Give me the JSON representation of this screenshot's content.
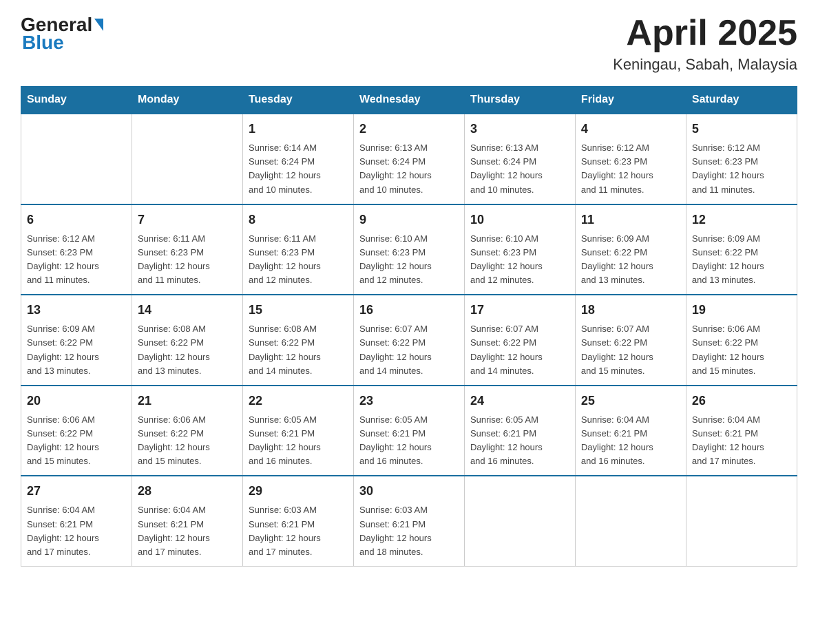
{
  "logo": {
    "general": "General",
    "blue": "Blue"
  },
  "title": "April 2025",
  "subtitle": "Keningau, Sabah, Malaysia",
  "days_of_week": [
    "Sunday",
    "Monday",
    "Tuesday",
    "Wednesday",
    "Thursday",
    "Friday",
    "Saturday"
  ],
  "weeks": [
    [
      {
        "day": "",
        "info": ""
      },
      {
        "day": "",
        "info": ""
      },
      {
        "day": "1",
        "sunrise": "6:14 AM",
        "sunset": "6:24 PM",
        "daylight": "12 hours and 10 minutes."
      },
      {
        "day": "2",
        "sunrise": "6:13 AM",
        "sunset": "6:24 PM",
        "daylight": "12 hours and 10 minutes."
      },
      {
        "day": "3",
        "sunrise": "6:13 AM",
        "sunset": "6:24 PM",
        "daylight": "12 hours and 10 minutes."
      },
      {
        "day": "4",
        "sunrise": "6:12 AM",
        "sunset": "6:23 PM",
        "daylight": "12 hours and 11 minutes."
      },
      {
        "day": "5",
        "sunrise": "6:12 AM",
        "sunset": "6:23 PM",
        "daylight": "12 hours and 11 minutes."
      }
    ],
    [
      {
        "day": "6",
        "sunrise": "6:12 AM",
        "sunset": "6:23 PM",
        "daylight": "12 hours and 11 minutes."
      },
      {
        "day": "7",
        "sunrise": "6:11 AM",
        "sunset": "6:23 PM",
        "daylight": "12 hours and 11 minutes."
      },
      {
        "day": "8",
        "sunrise": "6:11 AM",
        "sunset": "6:23 PM",
        "daylight": "12 hours and 12 minutes."
      },
      {
        "day": "9",
        "sunrise": "6:10 AM",
        "sunset": "6:23 PM",
        "daylight": "12 hours and 12 minutes."
      },
      {
        "day": "10",
        "sunrise": "6:10 AM",
        "sunset": "6:23 PM",
        "daylight": "12 hours and 12 minutes."
      },
      {
        "day": "11",
        "sunrise": "6:09 AM",
        "sunset": "6:22 PM",
        "daylight": "12 hours and 13 minutes."
      },
      {
        "day": "12",
        "sunrise": "6:09 AM",
        "sunset": "6:22 PM",
        "daylight": "12 hours and 13 minutes."
      }
    ],
    [
      {
        "day": "13",
        "sunrise": "6:09 AM",
        "sunset": "6:22 PM",
        "daylight": "12 hours and 13 minutes."
      },
      {
        "day": "14",
        "sunrise": "6:08 AM",
        "sunset": "6:22 PM",
        "daylight": "12 hours and 13 minutes."
      },
      {
        "day": "15",
        "sunrise": "6:08 AM",
        "sunset": "6:22 PM",
        "daylight": "12 hours and 14 minutes."
      },
      {
        "day": "16",
        "sunrise": "6:07 AM",
        "sunset": "6:22 PM",
        "daylight": "12 hours and 14 minutes."
      },
      {
        "day": "17",
        "sunrise": "6:07 AM",
        "sunset": "6:22 PM",
        "daylight": "12 hours and 14 minutes."
      },
      {
        "day": "18",
        "sunrise": "6:07 AM",
        "sunset": "6:22 PM",
        "daylight": "12 hours and 15 minutes."
      },
      {
        "day": "19",
        "sunrise": "6:06 AM",
        "sunset": "6:22 PM",
        "daylight": "12 hours and 15 minutes."
      }
    ],
    [
      {
        "day": "20",
        "sunrise": "6:06 AM",
        "sunset": "6:22 PM",
        "daylight": "12 hours and 15 minutes."
      },
      {
        "day": "21",
        "sunrise": "6:06 AM",
        "sunset": "6:22 PM",
        "daylight": "12 hours and 15 minutes."
      },
      {
        "day": "22",
        "sunrise": "6:05 AM",
        "sunset": "6:21 PM",
        "daylight": "12 hours and 16 minutes."
      },
      {
        "day": "23",
        "sunrise": "6:05 AM",
        "sunset": "6:21 PM",
        "daylight": "12 hours and 16 minutes."
      },
      {
        "day": "24",
        "sunrise": "6:05 AM",
        "sunset": "6:21 PM",
        "daylight": "12 hours and 16 minutes."
      },
      {
        "day": "25",
        "sunrise": "6:04 AM",
        "sunset": "6:21 PM",
        "daylight": "12 hours and 16 minutes."
      },
      {
        "day": "26",
        "sunrise": "6:04 AM",
        "sunset": "6:21 PM",
        "daylight": "12 hours and 17 minutes."
      }
    ],
    [
      {
        "day": "27",
        "sunrise": "6:04 AM",
        "sunset": "6:21 PM",
        "daylight": "12 hours and 17 minutes."
      },
      {
        "day": "28",
        "sunrise": "6:04 AM",
        "sunset": "6:21 PM",
        "daylight": "12 hours and 17 minutes."
      },
      {
        "day": "29",
        "sunrise": "6:03 AM",
        "sunset": "6:21 PM",
        "daylight": "12 hours and 17 minutes."
      },
      {
        "day": "30",
        "sunrise": "6:03 AM",
        "sunset": "6:21 PM",
        "daylight": "12 hours and 18 minutes."
      },
      {
        "day": "",
        "info": ""
      },
      {
        "day": "",
        "info": ""
      },
      {
        "day": "",
        "info": ""
      }
    ]
  ],
  "labels": {
    "sunrise": "Sunrise:",
    "sunset": "Sunset:",
    "daylight": "Daylight:"
  }
}
